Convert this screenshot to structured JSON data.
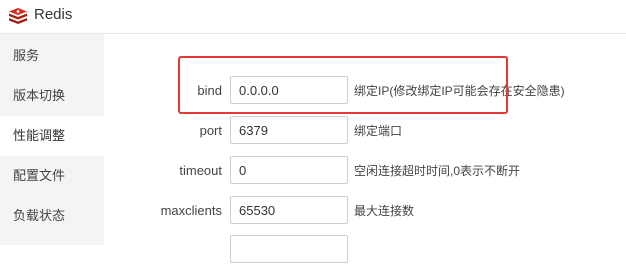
{
  "app": {
    "title": "Redis",
    "logo_icon": "redis-logo-icon"
  },
  "sidebar": {
    "items": [
      {
        "label": "服务",
        "active": false
      },
      {
        "label": "版本切换",
        "active": false
      },
      {
        "label": "性能调整",
        "active": true
      },
      {
        "label": "配置文件",
        "active": false
      },
      {
        "label": "负载状态",
        "active": false
      }
    ]
  },
  "settings": {
    "bind": {
      "label": "bind",
      "value": "0.0.0.0",
      "hint": "绑定IP(修改绑定IP可能会存在安全隐患)"
    },
    "port": {
      "label": "port",
      "value": "6379",
      "hint": "绑定端口"
    },
    "timeout": {
      "label": "timeout",
      "value": "0",
      "hint": "空闲连接超时时间,0表示不断开"
    },
    "maxclients": {
      "label": "maxclients",
      "value": "65530",
      "hint": "最大连接数"
    },
    "partial": {
      "value": ""
    }
  },
  "colors": {
    "highlight": "#e53935",
    "sidebar_bg": "#f4f4f4",
    "logo_red": "#c6302b"
  }
}
